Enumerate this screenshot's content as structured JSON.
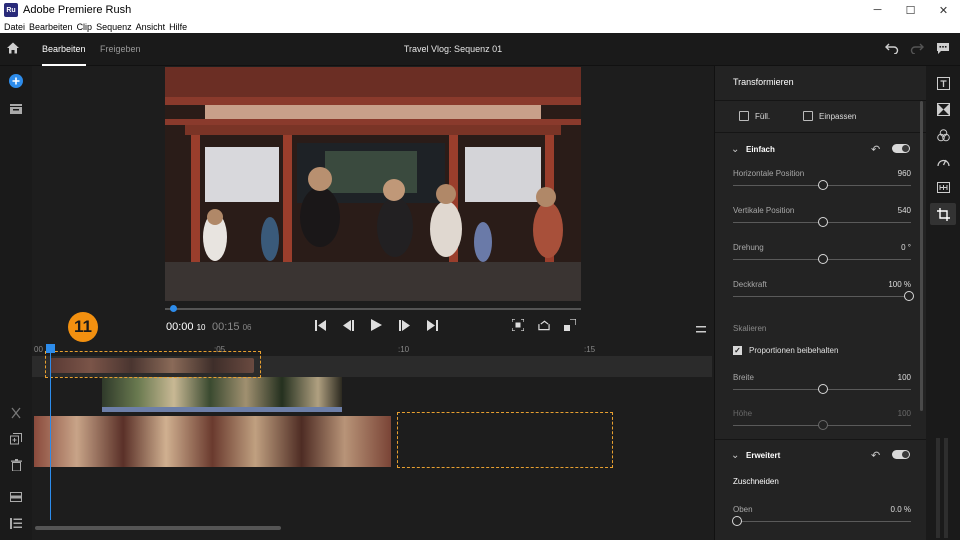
{
  "window": {
    "app_icon_text": "Ru",
    "title": "Adobe Premiere Rush",
    "controls": {
      "minimize": "─",
      "maximize": "☐",
      "close": "✕"
    }
  },
  "menu": [
    "Datei",
    "Bearbeiten",
    "Clip",
    "Sequenz",
    "Ansicht",
    "Hilfe"
  ],
  "topbar": {
    "tabs": [
      {
        "label": "Bearbeiten",
        "active": true
      },
      {
        "label": "Freigeben",
        "active": false
      }
    ],
    "sequence_title": "Travel Vlog: Sequenz 01"
  },
  "left_toolbar": [
    "add-media-icon",
    "project-icon",
    "split-icon",
    "duplicate-icon",
    "delete-icon",
    "track-icon",
    "track-list-icon"
  ],
  "monitor": {
    "timecode_current": "00:00",
    "timecode_current_frames": "10",
    "timecode_total": "00:15",
    "timecode_total_frames": "06",
    "playback_progress": 0.02
  },
  "timeline": {
    "ruler_ticks": [
      "00",
      ":05",
      ":10",
      ":15"
    ],
    "step_badge": "11"
  },
  "right_panel": {
    "title": "Transformieren",
    "fit_buttons": [
      "Füll.",
      "Einpassen"
    ],
    "section_basic": "Einfach",
    "basic_props": [
      {
        "label": "Horizontale Position",
        "value": "960",
        "level": 0.5,
        "dim": false
      },
      {
        "label": "Vertikale Position",
        "value": "540",
        "level": 0.5,
        "dim": false
      },
      {
        "label": "Drehung",
        "value": "0 °",
        "level": 0.5,
        "dim": false
      },
      {
        "label": "Deckkraft",
        "value": "100  %",
        "level": 1.0,
        "dim": false
      }
    ],
    "scale_label": "Skalieren",
    "keep_proportions": "Proportionen beibehalten",
    "scale_props": [
      {
        "label": "Breite",
        "value": "100",
        "level": 0.5,
        "dim": false
      },
      {
        "label": "Höhe",
        "value": "100",
        "level": 0.5,
        "dim": true
      }
    ],
    "section_advanced": "Erweitert",
    "crop_label": "Zuschneiden",
    "crop_props": [
      {
        "label": "Oben",
        "value": "0.0  %",
        "level": 0.0,
        "dim": false
      }
    ]
  },
  "right_toolbar": [
    "titles-icon",
    "transitions-icon",
    "color-icon",
    "speed-icon",
    "audio-icon",
    "crop-transform-icon"
  ],
  "colors": {
    "accent": "#2d8ceb",
    "badge": "#f29010",
    "dashed": "#e8a030"
  }
}
